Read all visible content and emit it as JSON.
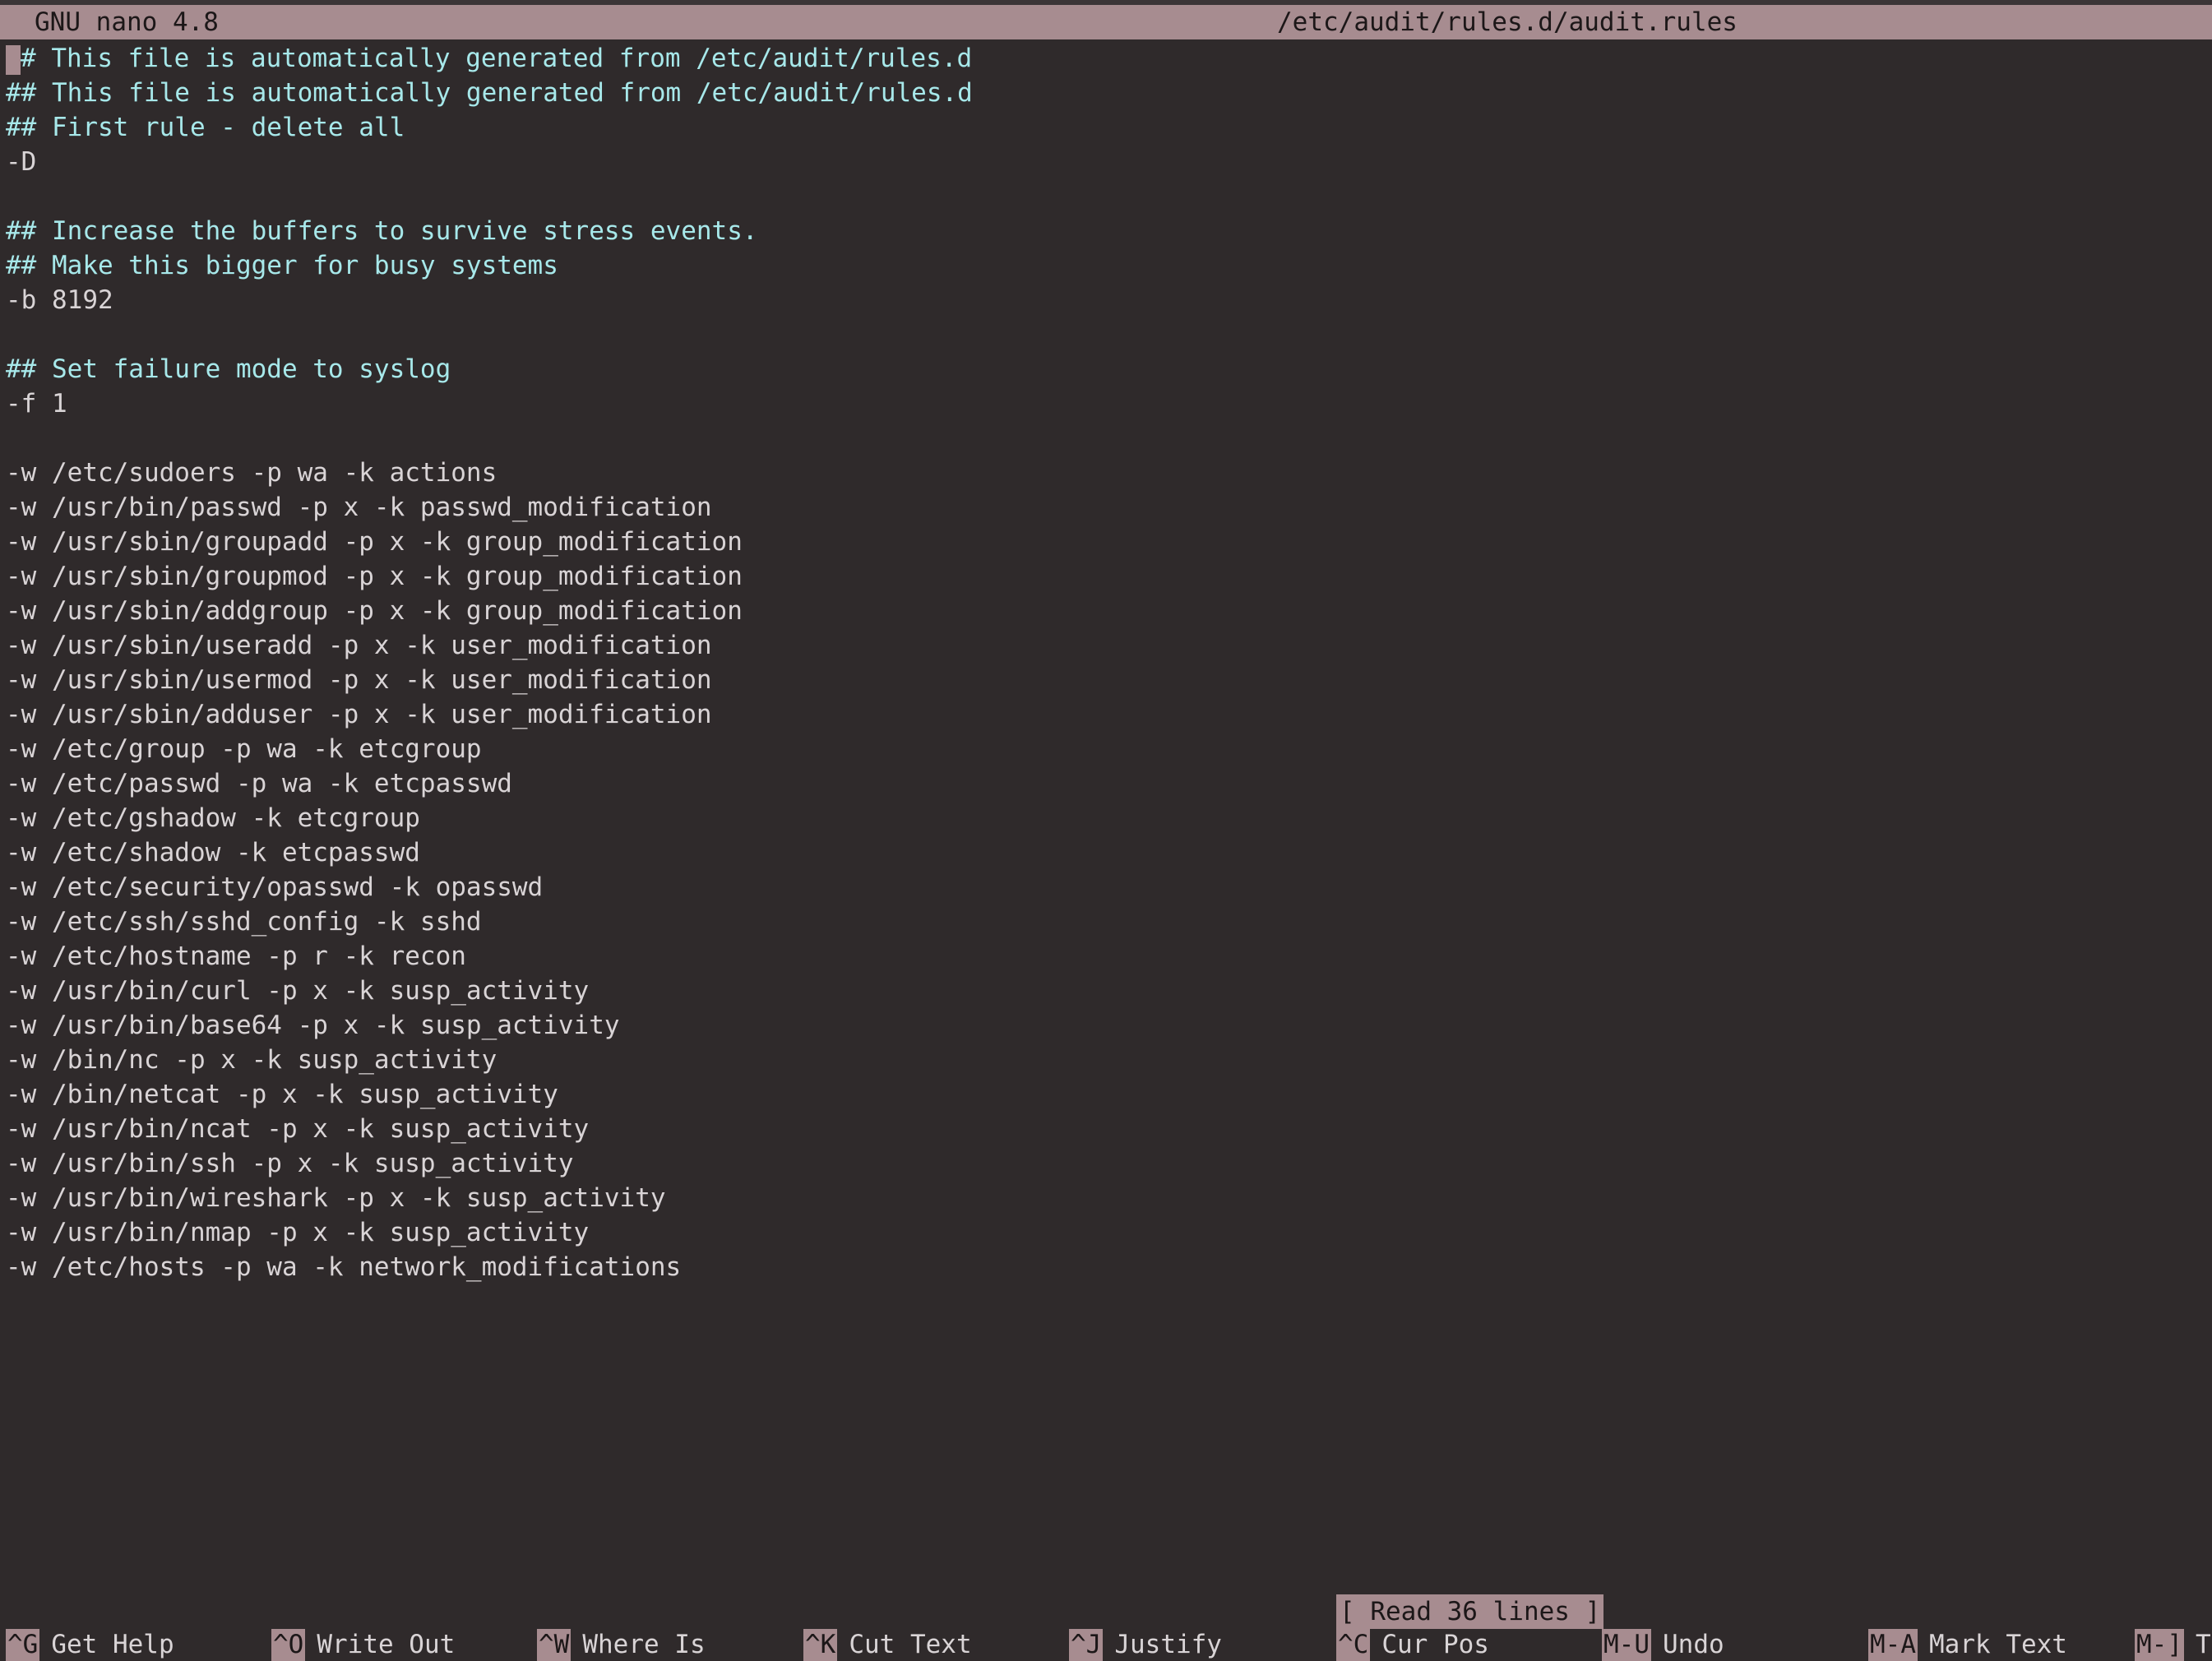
{
  "titlebar": {
    "app": "GNU nano 4.8",
    "file": "/etc/audit/rules.d/audit.rules"
  },
  "editor": {
    "first_line_rest": "# This file is automatically generated from /etc/audit/rules.d",
    "lines": [
      {
        "text": "## This file is automatically generated from /etc/audit/rules.d",
        "kind": "comment"
      },
      {
        "text": "## First rule - delete all",
        "kind": "comment"
      },
      {
        "text": "-D",
        "kind": "rule"
      },
      {
        "text": "",
        "kind": "rule"
      },
      {
        "text": "## Increase the buffers to survive stress events.",
        "kind": "comment"
      },
      {
        "text": "## Make this bigger for busy systems",
        "kind": "comment"
      },
      {
        "text": "-b 8192",
        "kind": "rule"
      },
      {
        "text": "",
        "kind": "rule"
      },
      {
        "text": "## Set failure mode to syslog",
        "kind": "comment"
      },
      {
        "text": "-f 1",
        "kind": "rule"
      },
      {
        "text": "",
        "kind": "rule"
      },
      {
        "text": "-w /etc/sudoers -p wa -k actions",
        "kind": "rule"
      },
      {
        "text": "-w /usr/bin/passwd -p x -k passwd_modification",
        "kind": "rule"
      },
      {
        "text": "-w /usr/sbin/groupadd -p x -k group_modification",
        "kind": "rule"
      },
      {
        "text": "-w /usr/sbin/groupmod -p x -k group_modification",
        "kind": "rule"
      },
      {
        "text": "-w /usr/sbin/addgroup -p x -k group_modification",
        "kind": "rule"
      },
      {
        "text": "-w /usr/sbin/useradd -p x -k user_modification",
        "kind": "rule"
      },
      {
        "text": "-w /usr/sbin/usermod -p x -k user_modification",
        "kind": "rule"
      },
      {
        "text": "-w /usr/sbin/adduser -p x -k user_modification",
        "kind": "rule"
      },
      {
        "text": "-w /etc/group -p wa -k etcgroup",
        "kind": "rule"
      },
      {
        "text": "-w /etc/passwd -p wa -k etcpasswd",
        "kind": "rule"
      },
      {
        "text": "-w /etc/gshadow -k etcgroup",
        "kind": "rule"
      },
      {
        "text": "-w /etc/shadow -k etcpasswd",
        "kind": "rule"
      },
      {
        "text": "-w /etc/security/opasswd -k opasswd",
        "kind": "rule"
      },
      {
        "text": "-w /etc/ssh/sshd_config -k sshd",
        "kind": "rule"
      },
      {
        "text": "-w /etc/hostname -p r -k recon",
        "kind": "rule"
      },
      {
        "text": "-w /usr/bin/curl -p x -k susp_activity",
        "kind": "rule"
      },
      {
        "text": "-w /usr/bin/base64 -p x -k susp_activity",
        "kind": "rule"
      },
      {
        "text": "-w /bin/nc -p x -k susp_activity",
        "kind": "rule"
      },
      {
        "text": "-w /bin/netcat -p x -k susp_activity",
        "kind": "rule"
      },
      {
        "text": "-w /usr/bin/ncat -p x -k susp_activity",
        "kind": "rule"
      },
      {
        "text": "-w /usr/bin/ssh -p x -k susp_activity",
        "kind": "rule"
      },
      {
        "text": "-w /usr/bin/wireshark -p x -k susp_activity",
        "kind": "rule"
      },
      {
        "text": "-w /usr/bin/nmap -p x -k susp_activity",
        "kind": "rule"
      },
      {
        "text": "-w /etc/hosts -p wa -k network_modifications",
        "kind": "rule"
      }
    ]
  },
  "status_message": "[ Read 36 lines ]",
  "shortcuts": [
    {
      "key": "^G",
      "label": "Get Help"
    },
    {
      "key": "^O",
      "label": "Write Out"
    },
    {
      "key": "^W",
      "label": "Where Is"
    },
    {
      "key": "^K",
      "label": "Cut Text"
    },
    {
      "key": "^J",
      "label": "Justify"
    },
    {
      "key": "^C",
      "label": "Cur Pos"
    },
    {
      "key": "M-U",
      "label": "Undo"
    },
    {
      "key": "M-A",
      "label": "Mark Text"
    },
    {
      "key": "M-]",
      "label": "T"
    }
  ],
  "colors": {
    "background": "#2f2a2b",
    "titlebar": "#a78c90",
    "comment_text": "#a7e8ea",
    "plain_text": "#d9d4d6"
  }
}
